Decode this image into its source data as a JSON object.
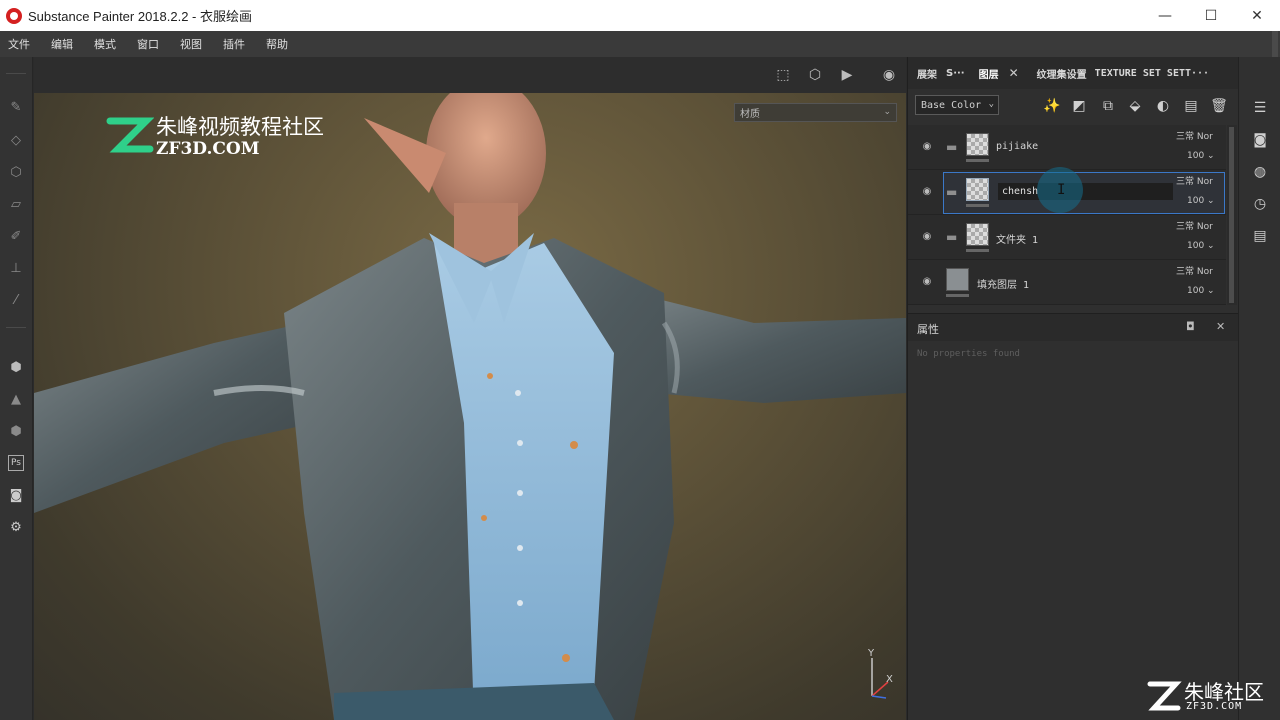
{
  "window": {
    "title": "Substance Painter 2018.2.2 - 衣服绘画",
    "minimize": "—",
    "maximize": "☐",
    "close": "✕"
  },
  "menu": [
    "文件",
    "编辑",
    "模式",
    "窗口",
    "视图",
    "插件",
    "帮助"
  ],
  "viewport": {
    "material_select": "材质",
    "watermark_cn": "朱峰视频教程社区",
    "watermark_en": "ZF3D.COM",
    "axis_y": "Y",
    "axis_x": "X"
  },
  "panel_tabs": {
    "tab1": "展架",
    "tab2": "S···",
    "tab3_active": "图层",
    "tab3_close": "✕",
    "tab4": "纹理集设置",
    "tab5": "TEXTURE SET SETT···"
  },
  "layer_toolbar": {
    "channel": "Base Color"
  },
  "layers": [
    {
      "name": "pijiake",
      "blend": "三常 Nor",
      "opacity": "100 ⌄",
      "has_folder": true
    },
    {
      "name": "chensh",
      "blend": "三常 Nor",
      "opacity": "100 ⌄",
      "has_folder": true,
      "selected": true,
      "editing": true
    },
    {
      "name": "文件夹 1",
      "blend": "三常 Nor",
      "opacity": "100 ⌄",
      "has_folder": true
    },
    {
      "name": "填充图层 1",
      "blend": "三常 Nor",
      "opacity": "100 ⌄",
      "has_folder": false
    }
  ],
  "properties": {
    "title": "属性",
    "empty_text": "No properties found",
    "float_btn": "◘",
    "close_btn": "✕"
  },
  "brand": {
    "cn": "朱峰社区",
    "en": "ZF3D.COM"
  },
  "colors": {
    "selection_border": "#3b78c8",
    "watermark_green": "#2fd08a",
    "title_bar": "#ffffff"
  }
}
